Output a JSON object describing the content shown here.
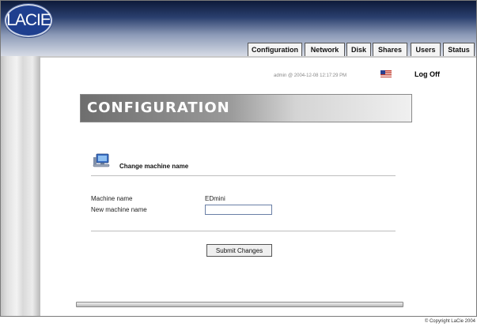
{
  "brand": {
    "logo_text": "LACIE"
  },
  "nav": {
    "tabs": [
      "Configuration",
      "Network",
      "Disk",
      "Shares",
      "Users",
      "Status"
    ]
  },
  "session": {
    "user_line": "admin @ 2004-12-08 12:17:29 PM",
    "logoff": "Log Off"
  },
  "page": {
    "title": "CONFIGURATION"
  },
  "section": {
    "title": "Change machine name",
    "machine_name_label": "Machine name",
    "machine_name_value": "EDmini",
    "new_name_label": "New machine name",
    "new_name_value": "",
    "submit_label": "Submit Changes"
  },
  "footer": {
    "copyright": "© Copyright LaCie 2004"
  },
  "colors": {
    "header_dark": "#0d1a3a",
    "tab_bg": "#f4f4f4",
    "logo_blue": "#1f3f8f"
  }
}
